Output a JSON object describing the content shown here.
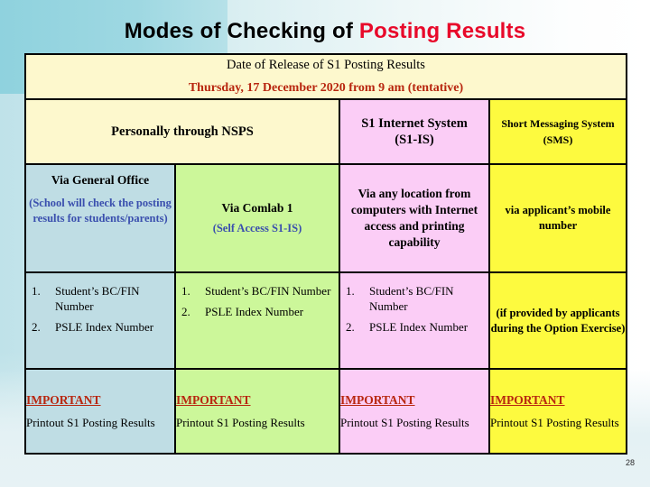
{
  "slide": {
    "title_main": "Modes of Checking of ",
    "title_accent": "Posting Results",
    "page_number": "28",
    "colors": {
      "accent_red": "#e8092a",
      "important_red": "#b8260f",
      "sub_blue": "#3a4fae",
      "col_cream": "#fdf8cd",
      "col_blue": "#bfdde4",
      "col_green": "#ccf79a",
      "col_pink": "#fbcdf6",
      "col_yellow": "#fdfa3f",
      "background_teal": "#8fd2de"
    }
  },
  "banner": {
    "line1": "Date of Release of S1 Posting Results",
    "line2": "Thursday, 17 December 2020 from 9 am (tentative)"
  },
  "headers": {
    "nsps": "Personally through NSPS",
    "s1is_line1": "S1 Internet System",
    "s1is_line2": "(S1-IS)",
    "sms_line1": "Short Messaging System",
    "sms_line2": "(SMS)"
  },
  "methods": {
    "general_office": {
      "title": "Via General Office",
      "sub": "(School will check the posting results for students/parents)"
    },
    "comlab": {
      "title": "Via Comlab 1",
      "sub": "(Self Access S1-IS)"
    },
    "internet": {
      "text": "Via any location from computers with Internet access and printing capability"
    },
    "sms": {
      "text": "via applicant’s mobile number"
    }
  },
  "requirements": {
    "general_office": [
      {
        "num": "1.",
        "text": "Student’s BC/FIN Number"
      },
      {
        "num": "2.",
        "text": "PSLE Index Number"
      }
    ],
    "comlab": [
      {
        "num": "1.",
        "text": "Student’s BC/FIN Number"
      },
      {
        "num": "2.",
        "text": "PSLE Index Number"
      }
    ],
    "internet": [
      {
        "num": "1.",
        "text": "Student’s BC/FIN Number"
      },
      {
        "num": "2.",
        "text": "PSLE Index Number"
      }
    ],
    "sms_note": "(if provided by applicants during the Option Exercise)"
  },
  "important": {
    "heading": "IMPORTANT",
    "body": "Printout S1 Posting Results"
  }
}
